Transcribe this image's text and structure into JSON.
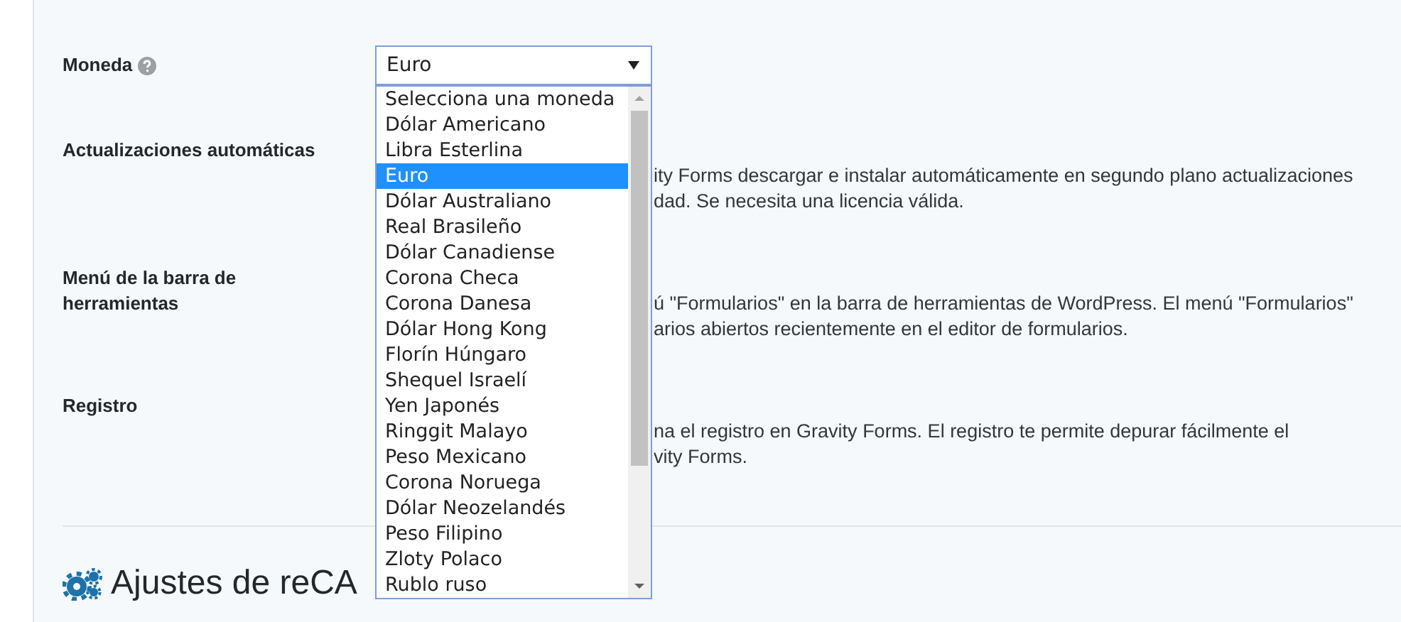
{
  "settings": [
    {
      "label": "Moneda",
      "help": true
    },
    {
      "label": "Actualizaciones automáticas",
      "description": [
        "ity Forms descargar e instalar automáticamente en segundo plano actualizaciones",
        "dad. Se necesita una licencia válida."
      ]
    },
    {
      "label": "Menú de la barra de herramientas",
      "description": [
        "ú \"Formularios\" en la barra de herramientas de WordPress. El menú \"Formularios\"",
        "arios abiertos recientemente en el editor de formularios."
      ]
    },
    {
      "label": "Registro",
      "description": [
        "na el registro en Gravity Forms. El registro te permite depurar fácilmente el",
        "vity Forms."
      ]
    }
  ],
  "currency_select": {
    "value": "Euro",
    "expanded": true,
    "options": [
      {
        "label": "Selecciona una moneda",
        "selected": false
      },
      {
        "label": "Dólar Americano",
        "selected": false
      },
      {
        "label": "Libra Esterlina",
        "selected": false
      },
      {
        "label": "Euro",
        "selected": true
      },
      {
        "label": "Dólar Australiano",
        "selected": false
      },
      {
        "label": "Real Brasileño",
        "selected": false
      },
      {
        "label": "Dólar Canadiense",
        "selected": false
      },
      {
        "label": "Corona Checa",
        "selected": false
      },
      {
        "label": "Corona Danesa",
        "selected": false
      },
      {
        "label": "Dólar Hong Kong",
        "selected": false
      },
      {
        "label": "Florín Húngaro",
        "selected": false
      },
      {
        "label": "Shequel Israelí",
        "selected": false
      },
      {
        "label": "Yen Japonés",
        "selected": false
      },
      {
        "label": "Ringgit Malayo",
        "selected": false
      },
      {
        "label": "Peso Mexicano",
        "selected": false
      },
      {
        "label": "Corona Noruega",
        "selected": false
      },
      {
        "label": "Dólar Neozelandés",
        "selected": false
      },
      {
        "label": "Peso Filipino",
        "selected": false
      },
      {
        "label": "Zloty Polaco",
        "selected": false
      },
      {
        "label": "Rublo ruso",
        "selected": false
      }
    ]
  },
  "section_heading": "Ajustes de reCA"
}
